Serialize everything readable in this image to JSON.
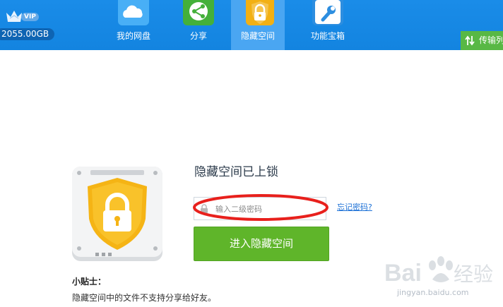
{
  "header": {
    "vip_badge": "VIP",
    "quota": "2055.00GB",
    "nav": [
      {
        "label": "我的网盘",
        "icon": "cloud-icon",
        "color": "#2fa4f5"
      },
      {
        "label": "分享",
        "icon": "share-icon",
        "color": "#44b03a"
      },
      {
        "label": "隐藏空间",
        "icon": "lock-shield-icon",
        "color": "#f2b014"
      },
      {
        "label": "功能宝箱",
        "icon": "wrench-icon",
        "color": "#2d8ee0"
      }
    ],
    "active_tab": "隐藏空间",
    "transfer_label": "传输列"
  },
  "main": {
    "title": "隐藏空间已上锁",
    "password_placeholder": "输入二级密码",
    "forgot_link": "忘记密码?",
    "enter_button": "进入隐藏空间",
    "tips_title": "小贴士：",
    "tips_text": "隐藏空间中的文件不支持分享给好友。"
  },
  "watermark": {
    "brand": "Bai 经验",
    "url": "jingyan.baidu.com"
  },
  "colors": {
    "topbar": "#1384e0",
    "active_tab": "#4aa6f2",
    "enter_button": "#5fb52a",
    "transfer_button": "#58b845",
    "annotation": "#e8201c"
  }
}
